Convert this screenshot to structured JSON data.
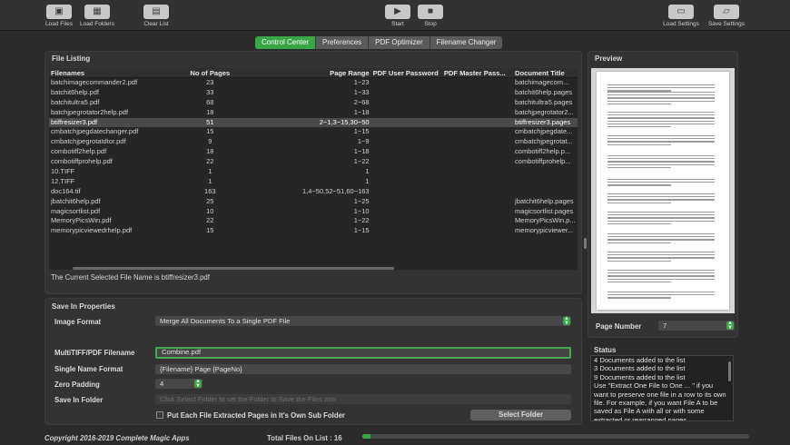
{
  "toolbar": {
    "load_files": "Load Files",
    "load_folders": "Load Folders",
    "clear_list": "Clear List",
    "start": "Start",
    "stop": "Stop",
    "load_settings": "Load Settings",
    "save_settings": "Save Settings"
  },
  "tabs": [
    "Control Center",
    "Preferences",
    "PDF Optimizer",
    "Filename Changer"
  ],
  "file_listing": {
    "title": "File Listing",
    "columns": [
      "Filenames",
      "No of Pages",
      "Page Range",
      "PDF User Password",
      "PDF Master Pass...",
      "Document Title"
    ],
    "rows": [
      [
        "batchimagecommander2.pdf",
        "23",
        "1−23",
        "",
        "",
        "batchimagecom..."
      ],
      [
        "batchit6help.pdf",
        "33",
        "1−33",
        "",
        "",
        "batchit6help.pages"
      ],
      [
        "batchitultra5.pdf",
        "68",
        "2−68",
        "",
        "",
        "batchitultra5.pages"
      ],
      [
        "batchjpegrotator2help.pdf",
        "18",
        "1−18",
        "",
        "",
        "batchjpegrotator2..."
      ],
      [
        "btiffresizer3.pdf",
        "51",
        "2−1,3−15,30−50",
        "",
        "",
        "btiffresizer3.pages"
      ],
      [
        "cmbatchjpegdatechanger.pdf",
        "15",
        "1−15",
        "",
        "",
        "cmbatchjpegdate..."
      ],
      [
        "cmbatchjpegrotatdtor.pdf",
        "9",
        "1−9",
        "",
        "",
        "cmbatchjpegrotat..."
      ],
      [
        "combotiff2help.pdf",
        "18",
        "1−18",
        "",
        "",
        "combotiff2help.p..."
      ],
      [
        "combotiffprohelp.pdf",
        "22",
        "1−22",
        "",
        "",
        "combotiffprohelp..."
      ],
      [
        "10.TIFF",
        "1",
        "1",
        "",
        "",
        ""
      ],
      [
        "12.TIFF",
        "1",
        "1",
        "",
        "",
        ""
      ],
      [
        "doc164.tif",
        "163",
        "1,4−50,52−51,60−163",
        "",
        "",
        ""
      ],
      [
        "jbatchit6help.pdf",
        "25",
        "1−25",
        "",
        "",
        "jbatchit6help.pages"
      ],
      [
        "magicsortlist.pdf",
        "10",
        "1−10",
        "",
        "",
        "magicsortlist.pages"
      ],
      [
        "MemoryPicsWin.pdf",
        "22",
        "1−22",
        "",
        "",
        "MemoryPicsWin.p..."
      ],
      [
        "memorypicviewedrhelp.pdf",
        "15",
        "1−15",
        "",
        "",
        "memorypicviewer..."
      ]
    ],
    "selected_index": 4,
    "current_file_text": "The Current Selected File Name is btiffresizer3.pdf"
  },
  "save_in": {
    "title": "Save In Properties",
    "image_format_label": "Image Format",
    "image_format_value": "Merge All Documents To a Single PDF File",
    "multitiff_label": "MultiTIFF/PDF Filename",
    "multitiff_value": "Combine.pdf",
    "single_name_label": "Single Name Format",
    "single_name_value": "{Filename} Page {PageNo}",
    "zero_padding_label": "Zero Padding",
    "zero_padding_value": "4",
    "save_in_folder_label": "Save In Folder",
    "save_in_folder_placeholder": "Click Select Folder to set the Folder to Save the Files Into",
    "put_each_label": "Put Each File Extracted Pages in It's Own Sub Folder",
    "select_folder_button": "Select Folder"
  },
  "preview": {
    "title": "Preview",
    "page_number_label": "Page Number",
    "page_number_value": "7"
  },
  "status": {
    "title": "Status",
    "lines": [
      "4 Documents added to the list",
      "3 Documents added to the list",
      "9 Documents added to the list",
      "Use \"Extract One File to One ... \" if you",
      "want to preserve one file in a row to its own",
      "file. For example, if you want File A to be",
      "saved as File A with all or with some",
      "extracted or rearranged pages."
    ]
  },
  "footer": {
    "copyright": "Copyright 2016-2019 Complete Magic Apps",
    "total_files": "Total Files On List : 16",
    "progress": 0.02
  },
  "colors": {
    "accent": "#39a646",
    "background": "#2b2b2b",
    "panel": "#333333"
  }
}
